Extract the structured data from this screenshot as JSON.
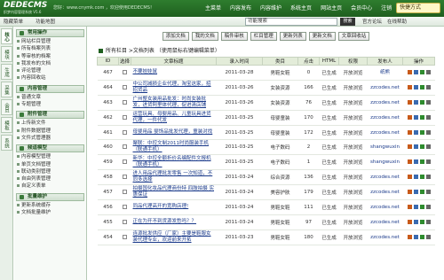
{
  "logo": {
    "line1": "DEDECMS",
    "line2": "织梦内容管理系统 V5.6"
  },
  "welcome": "您好：www.cnymk.com ，欢迎使用DEDECMS！",
  "topnav": [
    "主菜单",
    "内容发布",
    "内容维护",
    "系统主页",
    "网站主页",
    "会员中心",
    "注销"
  ],
  "quick_menu": "快捷方式",
  "subbar": {
    "menu_toggle": "隐藏菜单",
    "function_map": "功能地图",
    "keyword_value": "功能搜索",
    "search_label": "搜索",
    "links": [
      "官方论坛",
      "在线帮助"
    ]
  },
  "vtabs": [
    "核心",
    "模块",
    "生成",
    "采集",
    "会员",
    "模板",
    "系统"
  ],
  "sidebar": {
    "groups": [
      {
        "title": "常用操作",
        "items": [
          "网站栏目管理",
          "所有档案列表",
          "等审核的档案",
          "我发布的文档",
          "评论管理",
          "内容回收站"
        ]
      },
      {
        "title": "内容管理",
        "items": [
          "普通文章",
          "专题管理"
        ]
      },
      {
        "title": "附件管理",
        "items": [
          "上传新文件",
          "附件数据管理",
          "文件式管理器"
        ]
      },
      {
        "title": "频道模型",
        "items": [
          "内容模型管理",
          "单页文档管理",
          "联动类别管理",
          "自由列表管理",
          "自定义表单"
        ]
      },
      {
        "title": "批量维护",
        "items": [
          "更新系统缓存",
          "文档批量维护"
        ]
      }
    ]
  },
  "actions": [
    "添加文档",
    "我的文档",
    "稿件审核",
    "栏目管理",
    "更新列表",
    "更新文档",
    "文章回收站"
  ],
  "breadcrumb": "所有栏目 >文档列表 （使用鼠标右键编辑菜单）",
  "table": {
    "columns": [
      "ID",
      "选择",
      "文章标题",
      "录入时间",
      "类目",
      "点击",
      "HTML",
      "权限",
      "发布人",
      "操作"
    ],
    "rows": [
      [
        "467",
        "",
        "不要娃娃鼠",
        "2011-03-28",
        "男鞋女鞋",
        "0",
        "已生成",
        "开放浏览",
        "纸熊"
      ],
      [
        "464",
        "",
        "中公司减损企业代理，淘宝这家，招招货品",
        "2011-03-26",
        "女装资源",
        "166",
        "已生成",
        "开放浏览",
        "zzcodes.net"
      ],
      [
        "463",
        "",
        "广州整女装用品批发：时尚女装批发，进货阿里体代理，促进清店铺",
        "2011-03-26",
        "女装资源",
        "76",
        "已生成",
        "开放浏览",
        "zzcodes.net"
      ],
      [
        "462",
        "",
        "运营玩具、母婴用品、儿童玩具进货代理，一件代发",
        "2011-03-25",
        "母婴童装",
        "170",
        "已生成",
        "开放浏览",
        "zzcodes.net"
      ],
      [
        "461",
        "",
        "母婴用品 婴饰品批发代理，童装对找",
        "2011-03-25",
        "母婴童装",
        "172",
        "已生成",
        "开放浏览",
        "zzcodes.net"
      ],
      [
        "460",
        "",
        "聚联：中控文制2011时尚服装手机（联通手机）",
        "2011-03-25",
        "电子数码",
        "2",
        "已生成",
        "开放浏览",
        "shangwuxin"
      ],
      [
        "459",
        "",
        "新华：中控全额折价名编配件文报机（联通手机）",
        "2011-03-25",
        "电子数码",
        "1",
        "已生成",
        "开放浏览",
        "shangwuxin"
      ],
      [
        "458",
        "",
        "进人用品代理批发零售 一次知道，不同多选择",
        "2011-03-24",
        "综合资源",
        "136",
        "已生成",
        "开放浏览",
        "zzcodes.net"
      ],
      [
        "457",
        "",
        "拍摄国化妆品代理商份特 四肢拍摄 实惠保证",
        "2011-03-24",
        "美容护肤",
        "179",
        "已生成",
        "开放浏览",
        "zzcodes.net"
      ],
      [
        "456",
        "",
        "同品代理高开的宽购店理!",
        "2011-03-24",
        "男鞋女鞋",
        "111",
        "已生成",
        "开放浏览",
        "zzcodes.net"
      ],
      [
        "455",
        "",
        "正在为开不到货源发愁吗？？",
        "2011-03-24",
        "男鞋女鞋",
        "97",
        "已生成",
        "开放浏览",
        "zzcodes.net"
      ],
      [
        "454",
        "",
        "连源批发供应（厂家）主要是鞋服女装代理专业，欢迎前来开拓",
        "2011-03-23",
        "男鞋女鞋",
        "180",
        "已生成",
        "开放浏览",
        "zzcodes.net"
      ]
    ]
  },
  "colors": {
    "header_green": "#2e7d2e",
    "link_blue": "#1a3a8a",
    "table_head": "#e3ecd9"
  }
}
